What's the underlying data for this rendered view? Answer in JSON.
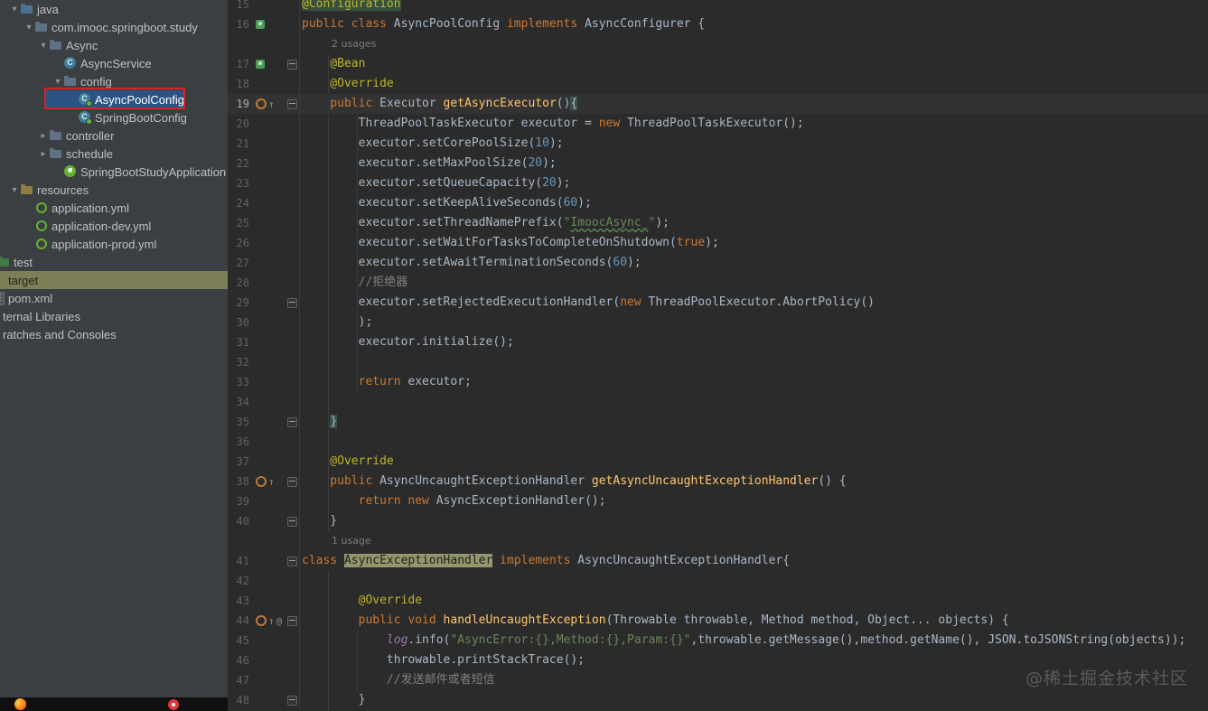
{
  "project_tree": {
    "bg_color": "#3c3f41",
    "selection_color": "#2b5382",
    "highlight_color": "#7e7e57",
    "selected_item": "AsyncPoolConfig",
    "items": [
      {
        "label": "java",
        "level": 1,
        "chevron": "expanded",
        "icon": "folder-source"
      },
      {
        "label": "com.imooc.springboot.study",
        "level": 2,
        "chevron": "expanded",
        "icon": "package"
      },
      {
        "label": "Async",
        "level": 3,
        "chevron": "expanded",
        "icon": "package"
      },
      {
        "label": "AsyncService",
        "level": 4,
        "chevron": null,
        "icon": "class"
      },
      {
        "label": "config",
        "level": 4,
        "chevron": "expanded",
        "icon": "package"
      },
      {
        "label": "AsyncPoolConfig",
        "level": 5,
        "chevron": null,
        "icon": "class-config",
        "state": "selected"
      },
      {
        "label": "SpringBootConfig",
        "level": 5,
        "chevron": null,
        "icon": "class-config"
      },
      {
        "label": "controller",
        "level": 3,
        "chevron": "collapsed",
        "icon": "package"
      },
      {
        "label": "schedule",
        "level": 3,
        "chevron": "collapsed",
        "icon": "package"
      },
      {
        "label": "SpringBootStudyApplication",
        "level": 4,
        "chevron": null,
        "icon": "spring-boot-class"
      },
      {
        "label": "resources",
        "level": 1,
        "chevron": "expanded",
        "icon": "folder-resources"
      },
      {
        "label": "application.yml",
        "level": 2,
        "chevron": null,
        "icon": "spring-yml"
      },
      {
        "label": "application-dev.yml",
        "level": 2,
        "chevron": null,
        "icon": "spring-yml"
      },
      {
        "label": "application-prod.yml",
        "level": 2,
        "chevron": null,
        "icon": "spring-yml"
      },
      {
        "label": "test",
        "level": 0,
        "offset": -16,
        "chevron": null,
        "icon": "folder-test"
      },
      {
        "label": "target",
        "level": 0,
        "offset": -6,
        "chevron": null,
        "icon": null,
        "state": "highlighted"
      },
      {
        "label": "pom.xml",
        "level": 0,
        "offset": -22,
        "chevron": null,
        "icon": "xml-file"
      },
      {
        "label": "ternal Libraries",
        "level": 0,
        "offset": -12,
        "chevron": null,
        "icon": null
      },
      {
        "label": "ratches and Consoles",
        "level": 0,
        "offset": -12,
        "chevron": null,
        "icon": null
      }
    ]
  },
  "editor": {
    "bg_color": "#2b2b2b",
    "current_line": 19,
    "colors": {
      "keyword": "#cc7832",
      "annotation": "#bbb529",
      "string": "#6a8759",
      "number": "#6897bb",
      "comment": "#808080",
      "method": "#ffc66d",
      "default": "#a9b7c6",
      "field": "#9876aa",
      "line_number": "#606366",
      "current_line_bg": "#323232",
      "brace_match_bg": "#3b514d",
      "identifier_highlight_bg": "#94976c"
    },
    "rows": [
      {
        "n": 15,
        "tokens": [
          [
            "ah",
            "@Configuration"
          ]
        ],
        "gutter": [],
        "fold": null
      },
      {
        "n": 16,
        "tokens": [
          [
            "k",
            "public class "
          ],
          [
            "d",
            "AsyncPoolConfig "
          ],
          [
            "k",
            "implements "
          ],
          [
            "d",
            "AsyncConfigurer {"
          ]
        ],
        "gutter": [
          "bean"
        ],
        "fold": null
      },
      {
        "inlay": "2 usages",
        "indent": 33
      },
      {
        "n": 17,
        "tokens": [
          [
            "a",
            "    @Bean"
          ]
        ],
        "gutter": [
          "bean"
        ],
        "fold": "start"
      },
      {
        "n": 18,
        "tokens": [
          [
            "a",
            "    @Override"
          ]
        ],
        "gutter": [],
        "fold": null
      },
      {
        "n": 19,
        "current": true,
        "tokens": [
          [
            "k",
            "    public "
          ],
          [
            "d",
            "Executor "
          ],
          [
            "m",
            "getAsyncExecutor"
          ],
          [
            "d",
            "()"
          ],
          [
            "bh",
            "{"
          ]
        ],
        "gutter": [
          "oring",
          "up"
        ],
        "fold": "start"
      },
      {
        "n": 20,
        "tokens": [
          [
            "d",
            "        ThreadPoolTaskExecutor executor = "
          ],
          [
            "k",
            "new"
          ],
          [
            "d",
            " ThreadPoolTaskExecutor();"
          ]
        ],
        "gutter": [],
        "fold": null
      },
      {
        "n": 21,
        "tokens": [
          [
            "d",
            "        executor.setCorePoolSize("
          ],
          [
            "n",
            "10"
          ],
          [
            "d",
            ");"
          ]
        ],
        "gutter": [],
        "fold": null
      },
      {
        "n": 22,
        "tokens": [
          [
            "d",
            "        executor.setMaxPoolSize("
          ],
          [
            "n",
            "20"
          ],
          [
            "d",
            ");"
          ]
        ],
        "gutter": [],
        "fold": null
      },
      {
        "n": 23,
        "tokens": [
          [
            "d",
            "        executor.setQueueCapacity("
          ],
          [
            "n",
            "20"
          ],
          [
            "d",
            ");"
          ]
        ],
        "gutter": [],
        "fold": null
      },
      {
        "n": 24,
        "tokens": [
          [
            "d",
            "        executor.setKeepAliveSeconds("
          ],
          [
            "n",
            "60"
          ],
          [
            "d",
            ");"
          ]
        ],
        "gutter": [],
        "fold": null
      },
      {
        "n": 25,
        "tokens": [
          [
            "d",
            "        executor.setThreadNamePrefix("
          ],
          [
            "s",
            "\""
          ],
          [
            "su",
            "ImoocAsync_"
          ],
          [
            "s",
            "\""
          ],
          [
            "d",
            ");"
          ]
        ],
        "gutter": [],
        "fold": null
      },
      {
        "n": 26,
        "tokens": [
          [
            "d",
            "        executor.setWaitForTasksToCompleteOnShutdown("
          ],
          [
            "k",
            "true"
          ],
          [
            "d",
            ");"
          ]
        ],
        "gutter": [],
        "fold": null
      },
      {
        "n": 27,
        "tokens": [
          [
            "d",
            "        executor.setAwaitTerminationSeconds("
          ],
          [
            "n",
            "60"
          ],
          [
            "d",
            ");"
          ]
        ],
        "gutter": [],
        "fold": null
      },
      {
        "n": 28,
        "tokens": [
          [
            "c",
            "        //拒绝器"
          ]
        ],
        "gutter": [],
        "fold": null
      },
      {
        "n": 29,
        "tokens": [
          [
            "d",
            "        executor.setRejectedExecutionHandler("
          ],
          [
            "k",
            "new"
          ],
          [
            "d",
            " ThreadPoolExecutor.AbortPolicy()"
          ]
        ],
        "gutter": [],
        "fold": "start"
      },
      {
        "n": 30,
        "tokens": [
          [
            "d",
            "        );"
          ]
        ],
        "gutter": [],
        "fold": null
      },
      {
        "n": 31,
        "tokens": [
          [
            "d",
            "        executor.initialize();"
          ]
        ],
        "gutter": [],
        "fold": null
      },
      {
        "n": 32,
        "tokens": [],
        "gutter": [],
        "fold": null
      },
      {
        "n": 33,
        "tokens": [
          [
            "k",
            "        return"
          ],
          [
            "d",
            " executor;"
          ]
        ],
        "gutter": [],
        "fold": null
      },
      {
        "n": 34,
        "tokens": [],
        "gutter": [],
        "fold": null
      },
      {
        "n": 35,
        "tokens": [
          [
            "d",
            "    "
          ],
          [
            "bh",
            "}"
          ]
        ],
        "gutter": [],
        "fold": "end"
      },
      {
        "n": 36,
        "tokens": [],
        "gutter": [],
        "fold": null
      },
      {
        "n": 37,
        "tokens": [
          [
            "a",
            "    @Override"
          ]
        ],
        "gutter": [],
        "fold": null
      },
      {
        "n": 38,
        "tokens": [
          [
            "k",
            "    public "
          ],
          [
            "d",
            "AsyncUncaughtExceptionHandler "
          ],
          [
            "m",
            "getAsyncUncaughtExceptionHandler"
          ],
          [
            "d",
            "() {"
          ]
        ],
        "gutter": [
          "oring",
          "up"
        ],
        "fold": "start"
      },
      {
        "n": 39,
        "tokens": [
          [
            "k",
            "        return new "
          ],
          [
            "d",
            "AsyncExceptionHandler();"
          ]
        ],
        "gutter": [],
        "fold": null
      },
      {
        "n": 40,
        "tokens": [
          [
            "d",
            "    }"
          ]
        ],
        "gutter": [],
        "fold": "end"
      },
      {
        "inlay": "1 usage",
        "indent": 33
      },
      {
        "n": 41,
        "tokens": [
          [
            "k",
            "class "
          ],
          [
            "ih",
            "AsyncExceptionHandler"
          ],
          [
            "d",
            " "
          ],
          [
            "k",
            "implements "
          ],
          [
            "d",
            "AsyncUncaughtExceptionHandler{"
          ]
        ],
        "gutter": [],
        "fold": "start"
      },
      {
        "n": 42,
        "tokens": [],
        "gutter": [],
        "fold": null
      },
      {
        "n": 43,
        "tokens": [
          [
            "a",
            "        @Override"
          ]
        ],
        "gutter": [],
        "fold": null
      },
      {
        "n": 44,
        "tokens": [
          [
            "k",
            "        public void "
          ],
          [
            "m",
            "handleUncaughtException"
          ],
          [
            "d",
            "(Throwable throwable, Method method, Object... objects) {"
          ]
        ],
        "gutter": [
          "oring",
          "up",
          "at"
        ],
        "fold": "start"
      },
      {
        "n": 45,
        "tokens": [
          [
            "d",
            "            "
          ],
          [
            "f",
            "log"
          ],
          [
            "d",
            ".info("
          ],
          [
            "s",
            "\"AsyncError:{},Method:{},Param:{}\""
          ],
          [
            "d",
            ",throwable.getMessage(),method.getName(), JSON.toJSONString(objects));"
          ]
        ],
        "gutter": [],
        "fold": null
      },
      {
        "n": 46,
        "tokens": [
          [
            "d",
            "            throwable.printStackTrace();"
          ]
        ],
        "gutter": [],
        "fold": null
      },
      {
        "n": 47,
        "tokens": [
          [
            "c",
            "            //发送邮件或者短信"
          ]
        ],
        "gutter": [],
        "fold": null
      },
      {
        "n": 48,
        "tokens": [
          [
            "d",
            "        }"
          ]
        ],
        "gutter": [],
        "fold": "end"
      }
    ]
  },
  "annotation": {
    "type": "red-box",
    "target": "AsyncPoolConfig",
    "color": "#dd2222"
  },
  "watermark": {
    "text": "@稀土掘金技术社区"
  },
  "taskbar": {
    "icons": [
      "browser-icon",
      "music-app-icon"
    ]
  }
}
